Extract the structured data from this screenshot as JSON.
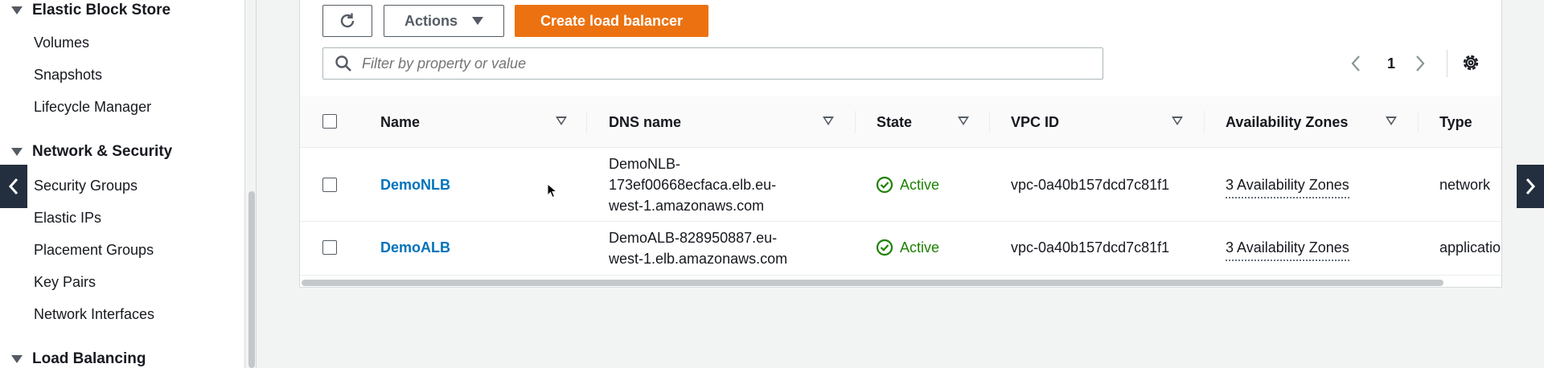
{
  "sidebar": {
    "sections": [
      {
        "title": "Elastic Block Store",
        "items": [
          "Volumes",
          "Snapshots",
          "Lifecycle Manager"
        ]
      },
      {
        "title": "Network & Security",
        "items": [
          "Security Groups",
          "Elastic IPs",
          "Placement Groups",
          "Key Pairs",
          "Network Interfaces"
        ]
      },
      {
        "title": "Load Balancing",
        "items": []
      }
    ]
  },
  "toolbar": {
    "actions_label": "Actions",
    "create_label": "Create load balancer"
  },
  "search": {
    "placeholder": "Filter by property or value"
  },
  "pagination": {
    "current_page": "1"
  },
  "table": {
    "columns": [
      "Name",
      "DNS name",
      "State",
      "VPC ID",
      "Availability Zones",
      "Type"
    ],
    "rows": [
      {
        "name": "DemoNLB",
        "dns_lines": [
          "DemoNLB-",
          "173ef00668ecfaca.elb.eu-",
          "west-1.amazonaws.com"
        ],
        "state": "Active",
        "vpc_id": "vpc-0a40b157dcd7c81f1",
        "availability_zones": "3 Availability Zones",
        "type": "network"
      },
      {
        "name": "DemoALB",
        "dns_lines": [
          "DemoALB-828950887.eu-",
          "west-1.elb.amazonaws.com"
        ],
        "state": "Active",
        "vpc_id": "vpc-0a40b157dcd7c81f1",
        "availability_zones": "3 Availability Zones",
        "type": "applicatio"
      }
    ]
  },
  "colors": {
    "primary_button": "#ec7211",
    "link": "#0073bb",
    "active": "#1d8102",
    "nav_dark": "#232f3e"
  }
}
